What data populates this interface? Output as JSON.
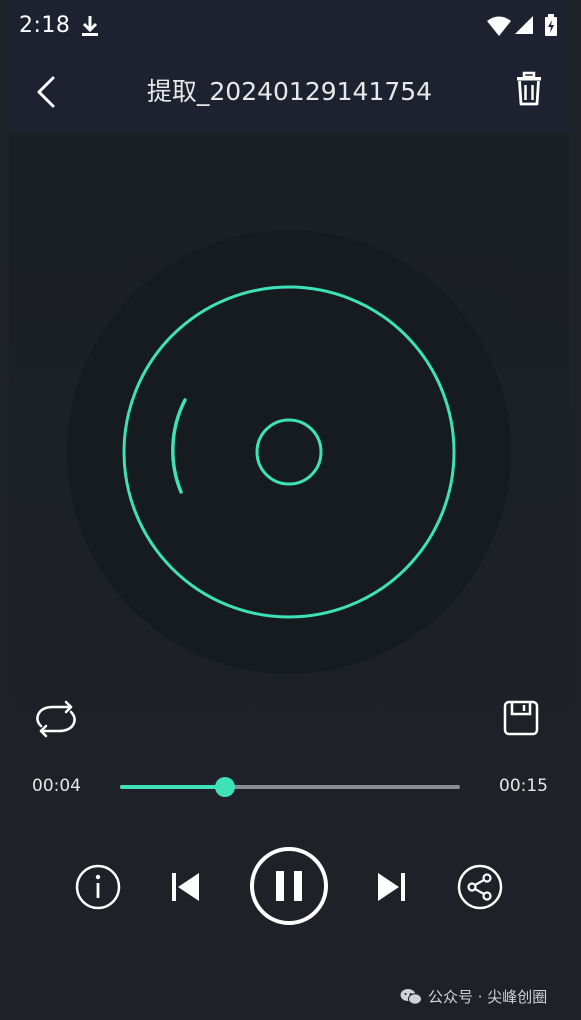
{
  "status_bar": {
    "time": "2:18"
  },
  "app_bar": {
    "title": "提取_20240129141754"
  },
  "player": {
    "current_time": "00:04",
    "total_time": "00:15",
    "progress": 0.31
  },
  "watermark": {
    "text": "公众号 · 尖峰创圈"
  },
  "colors": {
    "accent": "#3de2b8",
    "appbar": "#1e2130",
    "background": "#1d2127",
    "disc": "#161b20"
  },
  "icons": [
    "download-icon",
    "wifi-icon",
    "signal-icon",
    "battery-icon",
    "back-icon",
    "trash-icon",
    "disc-icon",
    "loop-icon",
    "save-icon",
    "info-icon",
    "previous-icon",
    "pause-icon",
    "next-icon",
    "share-icon",
    "wechat-icon"
  ]
}
